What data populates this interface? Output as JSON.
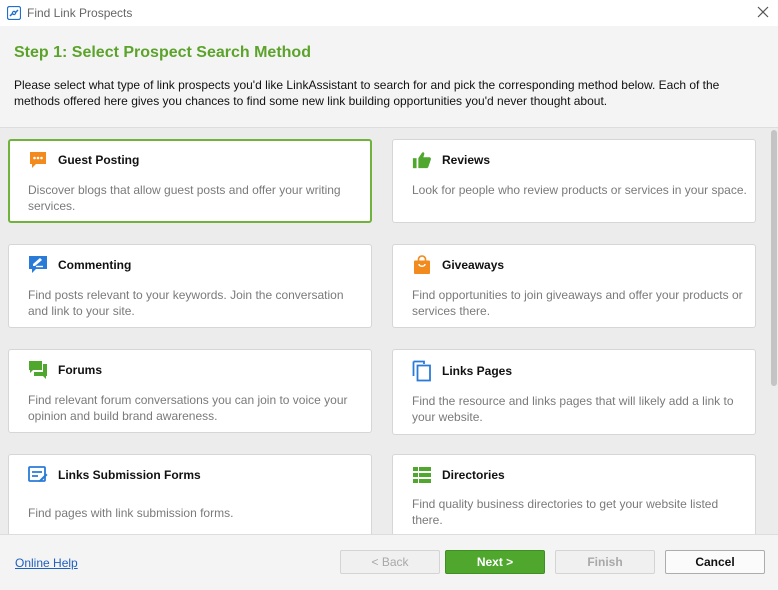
{
  "window": {
    "title": "Find Link Prospects"
  },
  "header": {
    "step_title": "Step 1: Select Prospect Search Method",
    "description": "Please select what type of link prospects you'd like LinkAssistant to search for and pick the corresponding method below. Each of the methods offered here gives you chances to find some new link building opportunities you'd never thought about."
  },
  "colors": {
    "accent_green": "#5ba32b",
    "selected_border": "#6fb33d",
    "icon_orange": "#f28a1e",
    "icon_green": "#4fa72e",
    "icon_blue": "#2a7bd8"
  },
  "methods": [
    {
      "title": "Guest Posting",
      "description": "Discover blogs that allow guest posts and offer your writing services.",
      "icon": "speech-bubble-icon",
      "selected": true
    },
    {
      "title": "Reviews",
      "description": "Look for people who review products or services in your space.",
      "icon": "thumbs-up-icon",
      "selected": false
    },
    {
      "title": "Commenting",
      "description": "Find posts relevant to your keywords. Join the conversation and link to your site.",
      "icon": "comment-pencil-icon",
      "selected": false
    },
    {
      "title": "Giveaways",
      "description": "Find opportunities to join giveaways and offer your products or services there.",
      "icon": "shopping-bag-icon",
      "selected": false
    },
    {
      "title": "Forums",
      "description": "Find relevant forum conversations you can join to voice your opinion and build brand awareness.",
      "icon": "forum-chat-icon",
      "selected": false
    },
    {
      "title": "Links Pages",
      "description": "Find the resource and links pages that will likely add a link to your website.",
      "icon": "pages-copy-icon",
      "selected": false
    },
    {
      "title": "Links Submission Forms",
      "description": "Find pages with link submission forms.",
      "icon": "form-edit-icon",
      "selected": false
    },
    {
      "title": "Directories",
      "description": "Find quality business directories to get your website listed there.",
      "icon": "directory-list-icon",
      "selected": false
    }
  ],
  "footer": {
    "help_link": "Online Help",
    "back_label": "< Back",
    "next_label": "Next >",
    "finish_label": "Finish",
    "cancel_label": "Cancel"
  }
}
